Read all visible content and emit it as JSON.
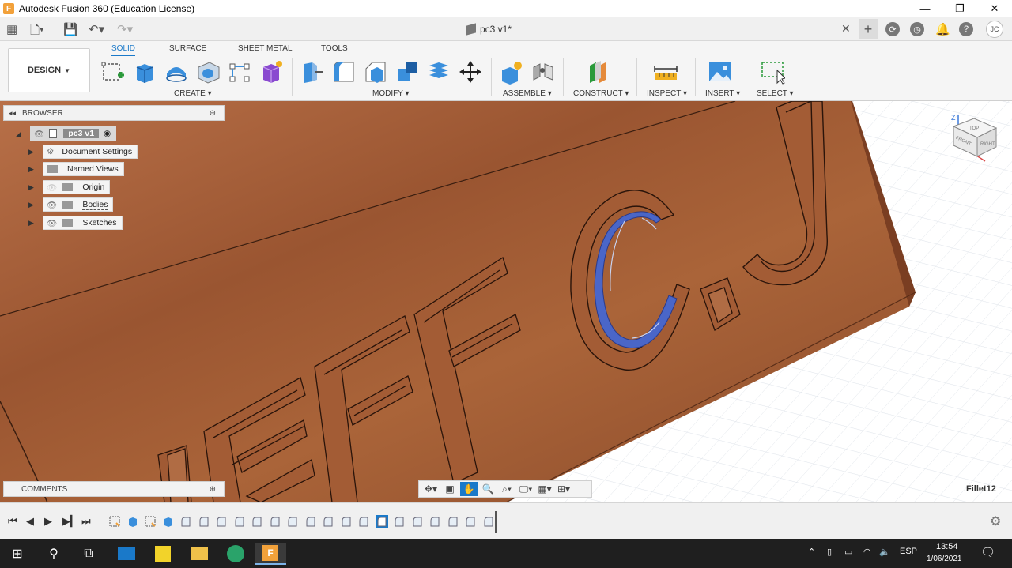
{
  "window": {
    "title": "Autodesk Fusion 360 (Education License)",
    "logo_letter": "F",
    "minimize": "—",
    "maximize": "❐",
    "close": "✕"
  },
  "tabbar": {
    "doc_tab": "pc3 v1*",
    "close_glyph": "✕",
    "new_tab_glyph": "+",
    "user_initials": "JC"
  },
  "ribbon": {
    "workspace": "DESIGN",
    "tabs": [
      "SOLID",
      "SURFACE",
      "SHEET METAL",
      "TOOLS"
    ],
    "groups": [
      "CREATE",
      "MODIFY",
      "ASSEMBLE",
      "CONSTRUCT",
      "INSPECT",
      "INSERT",
      "SELECT"
    ]
  },
  "browser": {
    "title": "BROWSER",
    "root": "pc3 v1",
    "items": [
      "Document Settings",
      "Named Views",
      "Origin",
      "Bodies",
      "Sketches"
    ]
  },
  "comments": {
    "title": "COMMENTS"
  },
  "status": {
    "feature": "Fillet12"
  },
  "viewcube": {
    "face_top": "TOP",
    "face_front": "FRONT",
    "face_right": "RIGHT",
    "axis_z": "Z"
  },
  "model_text": "JEFF C.J",
  "taskbar": {
    "lang": "ESP",
    "time": "13:54",
    "date": "1/06/2021"
  },
  "colors": {
    "accent": "#1a79c9",
    "model_surface": "#a8603a",
    "selection": "#4a66c8"
  }
}
